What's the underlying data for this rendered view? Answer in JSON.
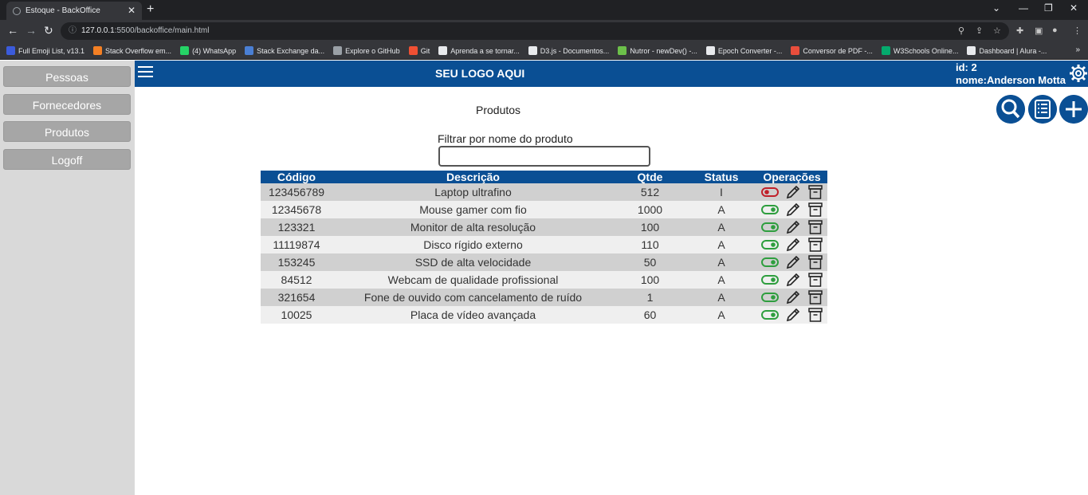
{
  "browser": {
    "tab_title": "Estoque - BackOffice",
    "url_host": "127.0.0.1",
    "url_path": ":5500/backoffice/main.html",
    "bookmarks": [
      {
        "label": "Full Emoji List, v13.1",
        "color": "#3b5bdb"
      },
      {
        "label": "Stack Overflow em...",
        "color": "#f48024"
      },
      {
        "label": "(4) WhatsApp",
        "color": "#25d366"
      },
      {
        "label": "Stack Exchange da...",
        "color": "#4a7fd4"
      },
      {
        "label": "Explore o GitHub",
        "color": "#9aa0a6"
      },
      {
        "label": "Git",
        "color": "#f05033"
      },
      {
        "label": "Aprenda a se tornar...",
        "color": "#e8eaed"
      },
      {
        "label": "D3.js - Documentos...",
        "color": "#e8eaed"
      },
      {
        "label": "Nutror - newDev() -...",
        "color": "#6cc04a"
      },
      {
        "label": "Epoch Converter -...",
        "color": "#e8eaed"
      },
      {
        "label": "Conversor de PDF -...",
        "color": "#e94e3c"
      },
      {
        "label": "W3Schools Online...",
        "color": "#04aa6d"
      },
      {
        "label": "Dashboard | Alura -...",
        "color": "#e8eaed"
      }
    ]
  },
  "sidebar": {
    "items": [
      {
        "label": "Pessoas"
      },
      {
        "label": "Fornecedores"
      },
      {
        "label": "Produtos"
      },
      {
        "label": "Logoff"
      }
    ]
  },
  "header": {
    "logo": "SEU LOGO AQUI",
    "user_id": "id: 2",
    "user_name": "nome:Anderson Motta"
  },
  "main": {
    "title": "Produtos",
    "filter_label": "Filtrar por nome do produto",
    "filter_value": ""
  },
  "table": {
    "headers": [
      "Código",
      "Descrição",
      "Qtde",
      "Status",
      "Operações"
    ],
    "rows": [
      {
        "codigo": "123456789",
        "descricao": "Laptop ultrafino",
        "qtde": "512",
        "status": "I",
        "active": false
      },
      {
        "codigo": "12345678",
        "descricao": "Mouse gamer com fio",
        "qtde": "1000",
        "status": "A",
        "active": true
      },
      {
        "codigo": "123321",
        "descricao": "Monitor de alta resolução",
        "qtde": "100",
        "status": "A",
        "active": true
      },
      {
        "codigo": "11119874",
        "descricao": "Disco rígido externo",
        "qtde": "110",
        "status": "A",
        "active": true
      },
      {
        "codigo": "153245",
        "descricao": "SSD de alta velocidade",
        "qtde": "50",
        "status": "A",
        "active": true
      },
      {
        "codigo": "84512",
        "descricao": "Webcam de qualidade profissional",
        "qtde": "100",
        "status": "A",
        "active": true
      },
      {
        "codigo": "321654",
        "descricao": "Fone de ouvido com cancelamento de ruído",
        "qtde": "1",
        "status": "A",
        "active": true
      },
      {
        "codigo": "10025",
        "descricao": "Placa de vídeo avançada",
        "qtde": "60",
        "status": "A",
        "active": true
      }
    ]
  },
  "colors": {
    "brand": "#0a4f94",
    "toggle_on": "#2e9e3e",
    "toggle_off": "#c0202a"
  },
  "icons": [
    "search-icon",
    "list-icon",
    "add-icon",
    "gear-icon",
    "toggle-icon",
    "pencil-icon",
    "archive-icon",
    "hamburger-icon"
  ]
}
